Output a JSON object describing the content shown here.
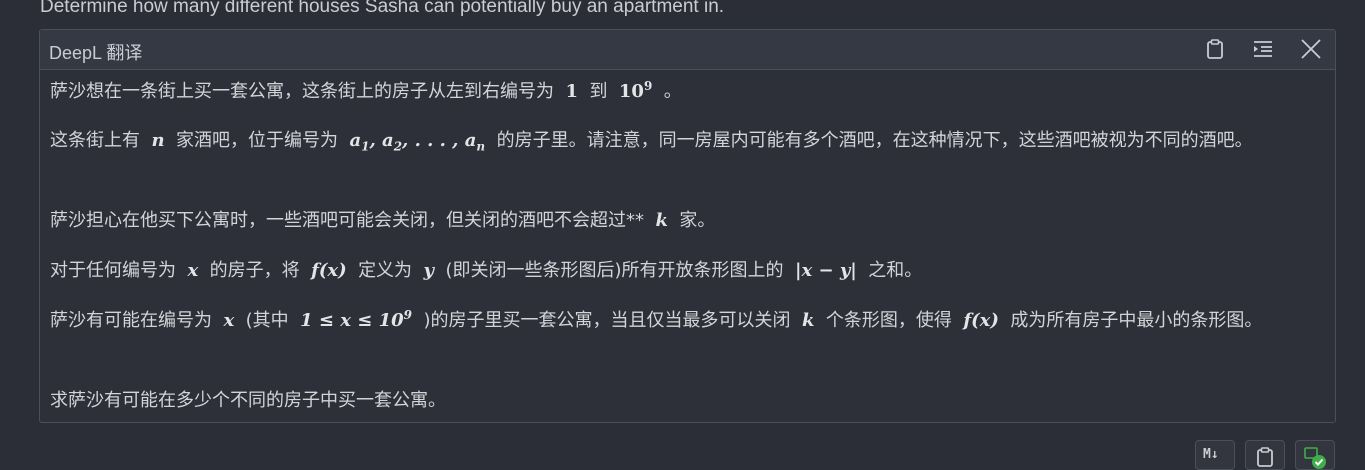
{
  "top_text": "Determine how many different houses Sasha can potentially buy an apartment in.",
  "panel": {
    "title": "DeepL 翻译",
    "icons": [
      "clipboard-icon",
      "indent-icon",
      "close-icon"
    ]
  },
  "paragraphs": {
    "p1": {
      "a": "萨沙想在一条街上买一套公寓，这条街上的房子从左到右编号为",
      "m1": "1",
      "b": "到",
      "m2": "10",
      "m2sup": "9",
      "c": "。"
    },
    "p2": {
      "a": "这条街上有",
      "m1": "n",
      "b": "家酒吧，位于编号为",
      "m2": "a",
      "m2sub1": "1",
      "m2b": ", a",
      "m2sub2": "2",
      "m2c": ", . . . , a",
      "m2sub3": "n",
      "c": "的房子里。请注意，同一房屋内可能有多个酒吧，在这种情况下，这些酒吧被视为不同的酒吧。"
    },
    "p3": {
      "a": "萨沙担心在他买下公寓时，一些酒吧可能会关闭，但关闭的酒吧不会超过**",
      "m1": "k",
      "b": "家。"
    },
    "p4": {
      "a": "对于任何编号为",
      "m1": "x",
      "b": "的房子，将",
      "m2": "f(x)",
      "c": "定义为",
      "m3": "y",
      "d": "(即关闭一些条形图后)所有开放条形图上的",
      "m4": "|x − y|",
      "e": "之和。"
    },
    "p5": {
      "a": "萨沙有可能在编号为",
      "m1": "x",
      "b": "(其中",
      "m2": "1 ≤ x ≤ 10",
      "m2sup": "9",
      "c": ")的房子里买一套公寓，当且仅当最多可以关闭",
      "m3": "k",
      "d": "个条形图，使得",
      "m4": "f(x)",
      "e": "成为所有房子中最小的条形图。"
    },
    "p6": {
      "a": "求萨沙有可能在多少个不同的房子中买一套公寓。"
    }
  },
  "bottom_buttons": {
    "md_label": "M↓"
  },
  "colors": {
    "accent_green": "#3fae4a"
  }
}
